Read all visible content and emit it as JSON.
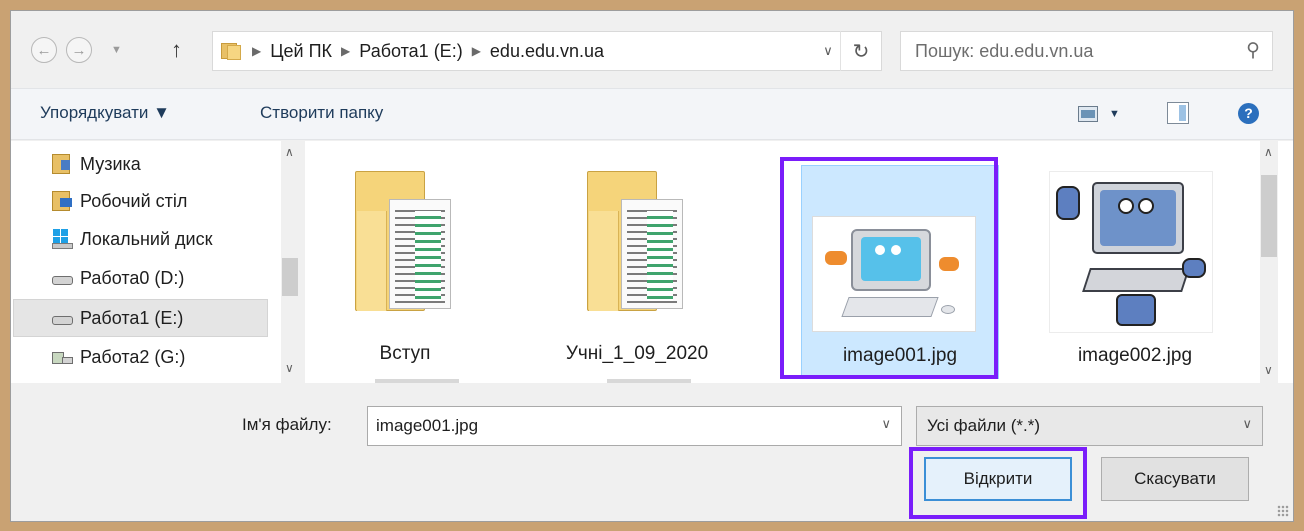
{
  "address": {
    "back_icon": "arrow-left-icon",
    "forward_icon": "arrow-right-icon",
    "up_icon": "arrow-up-icon",
    "crumbs": [
      "Цей ПК",
      "Работа1 (E:)",
      "edu.edu.vn.ua"
    ],
    "refresh_icon": "refresh-icon"
  },
  "search": {
    "placeholder": "Пошук: edu.edu.vn.ua"
  },
  "toolbar": {
    "organize_label": "Упорядкувати ▼",
    "new_folder_label": "Створити папку"
  },
  "nav": {
    "items": [
      {
        "label": "Музика",
        "icon": "music-folder-icon"
      },
      {
        "label": "Робочий стіл",
        "icon": "desktop-folder-icon"
      },
      {
        "label": "Локальний диск",
        "icon": "windows-drive-icon"
      },
      {
        "label": "Работа0 (D:)",
        "icon": "drive-icon"
      },
      {
        "label": "Работа1 (E:)",
        "icon": "drive-icon"
      },
      {
        "label": "Работа2 (G:)",
        "icon": "network-drive-icon"
      }
    ],
    "selected_index": 4
  },
  "files": [
    {
      "name": "Вступ",
      "type": "folder"
    },
    {
      "name": "Учні_1_09_2020",
      "type": "folder"
    },
    {
      "name": "image001.jpg",
      "type": "image",
      "selected": true
    },
    {
      "name": "image002.jpg",
      "type": "image"
    }
  ],
  "filename": {
    "label": "Ім'я файлу:",
    "value": "image001.jpg"
  },
  "filetype": {
    "value": "Усі файли (*.*)"
  },
  "buttons": {
    "open": "Відкрити",
    "cancel": "Скасувати"
  },
  "colors": {
    "highlight": "#7a1dfa",
    "selection": "#cce8ff",
    "frame": "#c9a273"
  }
}
